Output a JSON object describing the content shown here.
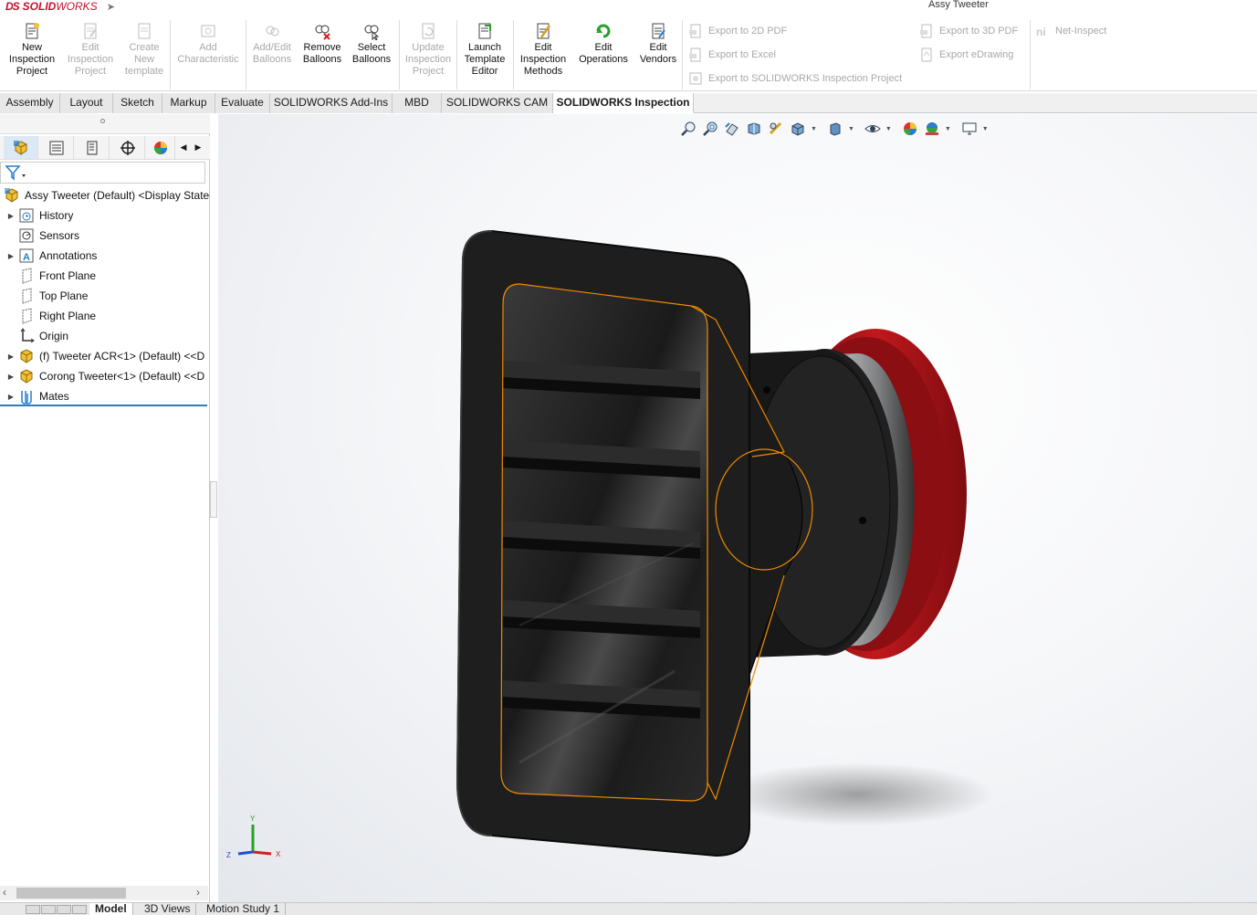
{
  "app": {
    "brand_ds": "DS",
    "brand_solid": "SOLID",
    "brand_works": "WORKS",
    "document_title": "Assy Tweeter"
  },
  "ribbon": {
    "buttons": [
      {
        "lines": [
          "New",
          "Inspection",
          "Project"
        ],
        "icon": "new-inspection-icon",
        "enabled": true
      },
      {
        "lines": [
          "Edit",
          "Inspection",
          "Project"
        ],
        "icon": "edit-inspection-icon",
        "enabled": false
      },
      {
        "lines": [
          "Create",
          "New",
          "template"
        ],
        "icon": "create-template-icon",
        "enabled": false
      },
      {
        "lines": [
          "Add",
          "Characteristic"
        ],
        "icon": "add-characteristic-icon",
        "enabled": false
      },
      {
        "lines": [
          "Add/Edit",
          "Balloons"
        ],
        "icon": "add-balloons-icon",
        "enabled": false
      },
      {
        "lines": [
          "Remove",
          "Balloons"
        ],
        "icon": "remove-balloons-icon",
        "enabled": true
      },
      {
        "lines": [
          "Select",
          "Balloons"
        ],
        "icon": "select-balloons-icon",
        "enabled": true
      },
      {
        "lines": [
          "Update",
          "Inspection",
          "Project"
        ],
        "icon": "update-inspection-icon",
        "enabled": false
      },
      {
        "lines": [
          "Launch",
          "Template",
          "Editor"
        ],
        "icon": "launch-template-icon",
        "enabled": true
      },
      {
        "lines": [
          "Edit",
          "Inspection",
          "Methods"
        ],
        "icon": "edit-methods-icon",
        "enabled": true
      },
      {
        "lines": [
          "Edit",
          "Operations"
        ],
        "icon": "edit-operations-icon",
        "enabled": true
      },
      {
        "lines": [
          "Edit",
          "Vendors"
        ],
        "icon": "edit-vendors-icon",
        "enabled": true
      }
    ],
    "export": {
      "pdf2d": "Export to 2D PDF",
      "excel": "Export to Excel",
      "inspection_project": "Export to SOLIDWORKS Inspection Project",
      "pdf3d": "Export to 3D PDF",
      "edrawing": "Export eDrawing",
      "net_inspect": "Net-Inspect"
    }
  },
  "tabs": [
    {
      "label": "Assembly",
      "active": false
    },
    {
      "label": "Layout",
      "active": false
    },
    {
      "label": "Sketch",
      "active": false
    },
    {
      "label": "Markup",
      "active": false
    },
    {
      "label": "Evaluate",
      "active": false
    },
    {
      "label": "SOLIDWORKS Add-Ins",
      "active": false
    },
    {
      "label": "MBD",
      "active": false
    },
    {
      "label": "SOLIDWORKS CAM",
      "active": false
    },
    {
      "label": "SOLIDWORKS Inspection",
      "active": true
    }
  ],
  "tree": {
    "root": "Assy Tweeter (Default) <Display State-",
    "items": [
      {
        "label": "History",
        "icon": "history-icon",
        "expandable": true
      },
      {
        "label": "Sensors",
        "icon": "sensors-icon",
        "expandable": false
      },
      {
        "label": "Annotations",
        "icon": "annotations-icon",
        "expandable": true
      },
      {
        "label": "Front Plane",
        "icon": "plane-icon",
        "expandable": false
      },
      {
        "label": "Top Plane",
        "icon": "plane-icon",
        "expandable": false
      },
      {
        "label": "Right Plane",
        "icon": "plane-icon",
        "expandable": false
      },
      {
        "label": "Origin",
        "icon": "origin-icon",
        "expandable": false
      },
      {
        "label": "(f) Tweeter ACR<1> (Default) <<D",
        "icon": "part-icon",
        "expandable": true
      },
      {
        "label": "Corong Tweeter<1> (Default) <<D",
        "icon": "part-icon",
        "expandable": true
      },
      {
        "label": "Mates",
        "icon": "mates-icon",
        "expandable": true
      }
    ]
  },
  "bottom_tabs": [
    {
      "label": "Model",
      "active": true
    },
    {
      "label": "3D Views",
      "active": false
    },
    {
      "label": "Motion Study 1",
      "active": false
    }
  ],
  "triad": {
    "x": "X",
    "y": "Y",
    "z": "Z"
  },
  "colors": {
    "accent_blue": "#2a7dc8",
    "selection_orange": "#f08a00",
    "brand_red": "#c8102e",
    "model_red": "#b01418",
    "model_black": "#1c1c1c",
    "model_grey": "#8c8c8c"
  }
}
